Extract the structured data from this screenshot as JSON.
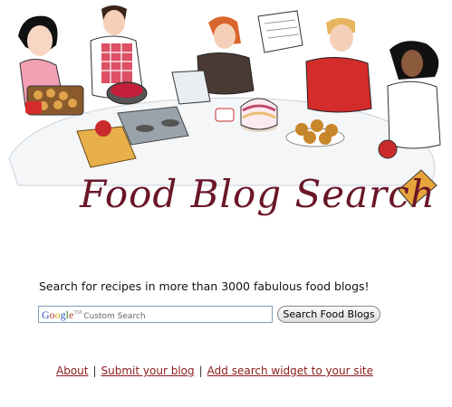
{
  "header": {
    "logo_text": "Food Blog Search"
  },
  "tagline": "Search for recipes in more than 3000 fabulous food blogs!",
  "search": {
    "google_letters": [
      "G",
      "o",
      "o",
      "g",
      "l",
      "e"
    ],
    "google_colors": [
      "#2a4fbf",
      "#c0392b",
      "#d9a406",
      "#2a4fbf",
      "#2e8b2e",
      "#c0392b"
    ],
    "tm": "TM",
    "watermark_text": "Custom Search",
    "button_label": "Search Food Blogs"
  },
  "footer": {
    "links": [
      "About",
      "Submit your blog",
      "Add search widget to your site"
    ],
    "separator": "|"
  }
}
